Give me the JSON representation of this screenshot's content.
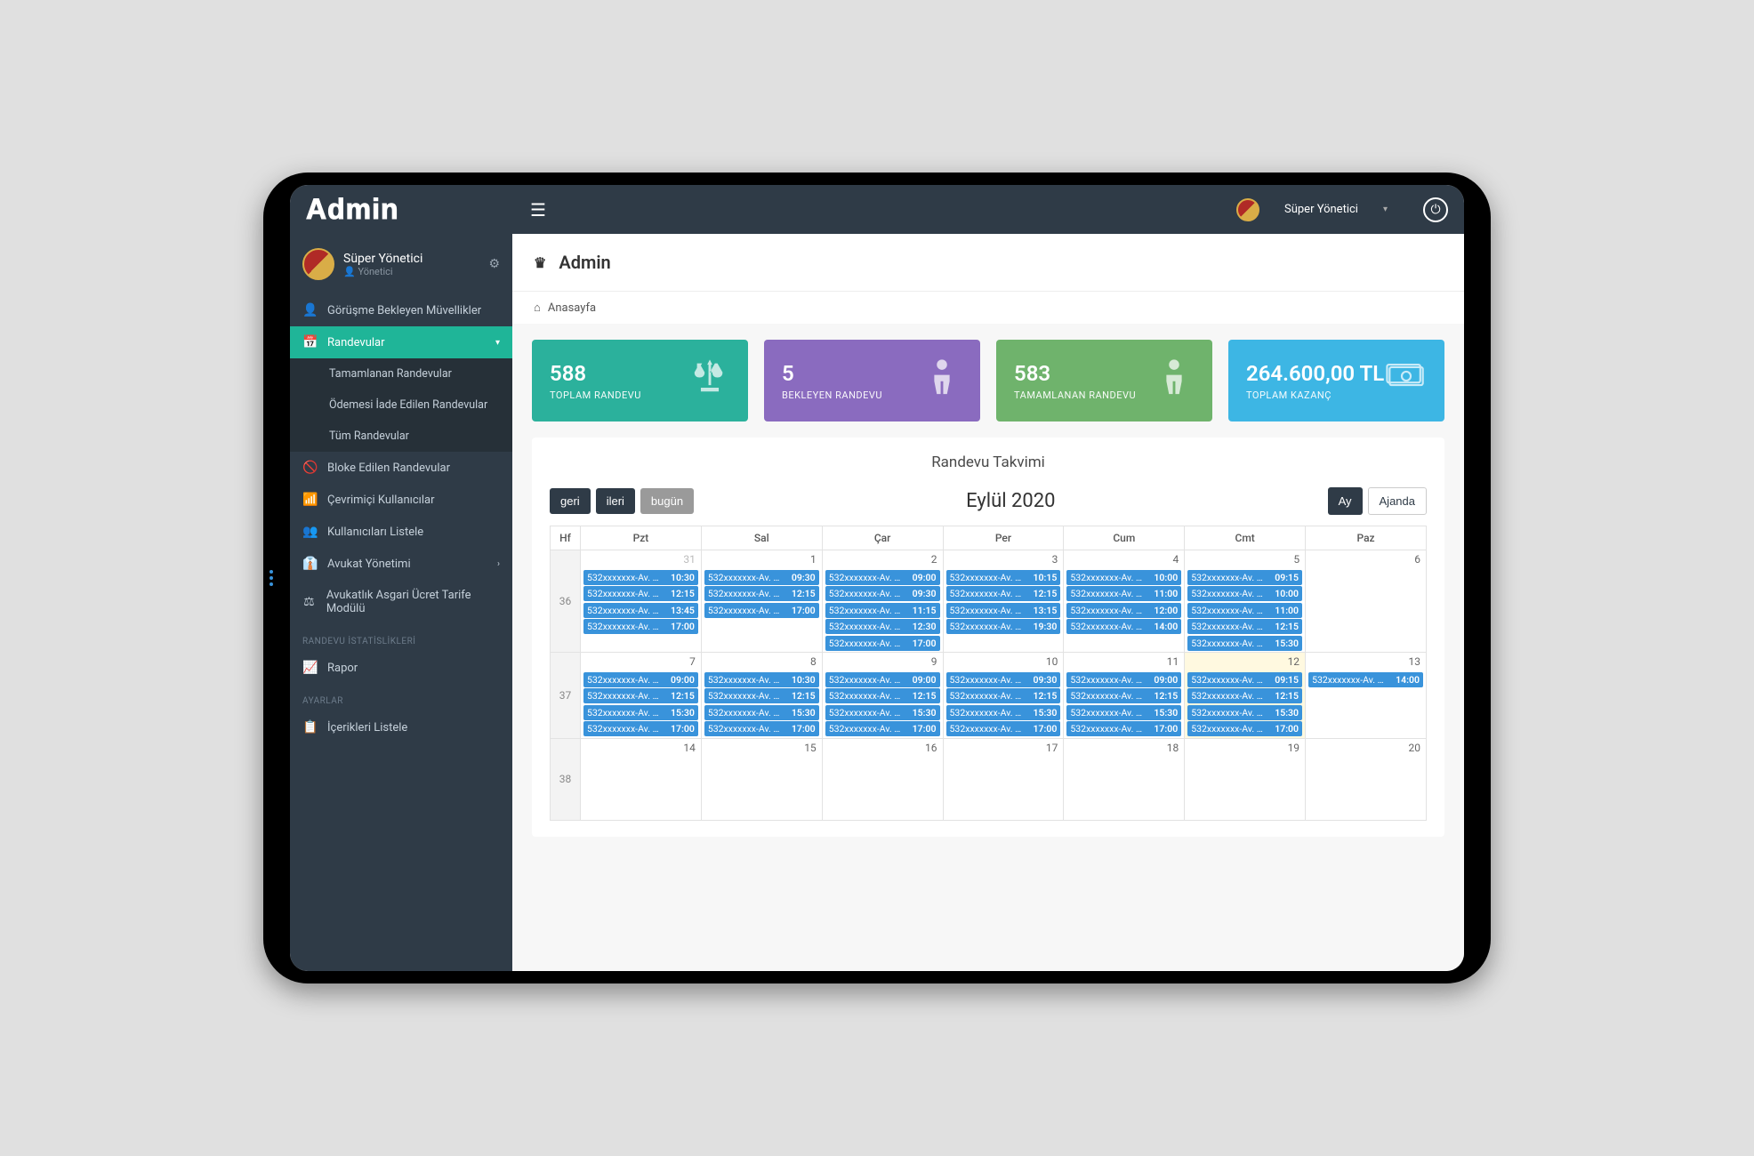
{
  "brand": "Admin",
  "topbar": {
    "user_name": "Süper Yönetici",
    "hamburger_label": "menu"
  },
  "sidebar": {
    "profile": {
      "name": "Süper Yönetici",
      "role": "Yönetici"
    },
    "items": [
      {
        "icon": "👤",
        "label": "Görüşme Bekleyen Müvellikler"
      },
      {
        "icon": "📅",
        "label": "Randevular",
        "active": true,
        "expandable": true
      },
      {
        "icon": "🚫",
        "label": "Bloke Edilen Randevular"
      },
      {
        "icon": "📶",
        "label": "Çevrimiçi Kullanıcılar"
      },
      {
        "icon": "👥",
        "label": "Kullanıcıları Listele"
      },
      {
        "icon": "👔",
        "label": "Avukat Yönetimi",
        "expandable": true
      },
      {
        "icon": "⚖",
        "label": "Avukatlık Asgari Ücret Tarife Modülü"
      }
    ],
    "sub_items": [
      {
        "label": "Tamamlanan Randevular"
      },
      {
        "label": "Ödemesi İade Edilen Randevular"
      },
      {
        "label": "Tüm Randevular"
      }
    ],
    "section_stats": "RANDEVU İSTATİSLİKLERİ",
    "rapor": {
      "icon": "📈",
      "label": "Rapor"
    },
    "section_settings": "AYARLAR",
    "icerik": {
      "icon": "📋",
      "label": "İçerikleri Listele"
    }
  },
  "page": {
    "title": "Admin",
    "breadcrumb": "Anasayfa"
  },
  "stats": [
    {
      "value": "588",
      "label": "TOPLAM RANDEVU",
      "color": "c-teal",
      "icon": "scale"
    },
    {
      "value": "5",
      "label": "BEKLEYEN RANDEVU",
      "color": "c-purple",
      "icon": "person"
    },
    {
      "value": "583",
      "label": "TAMAMLANAN RANDEVU",
      "color": "c-green",
      "icon": "person"
    },
    {
      "value": "264.600,00 TL",
      "label": "TOPLAM KAZANÇ",
      "color": "c-blue",
      "icon": "money"
    }
  ],
  "calendar": {
    "title": "Randevu Takvimi",
    "nav": {
      "prev": "geri",
      "next": "ileri",
      "today": "bugün"
    },
    "month_label": "Eylül 2020",
    "view": {
      "month": "Ay",
      "agenda": "Ajanda"
    },
    "week_header": "Hf",
    "day_headers": [
      "Pzt",
      "Sal",
      "Çar",
      "Per",
      "Cum",
      "Cmt",
      "Paz"
    ],
    "event_name_mask": "532xxxxxxx-Av. …",
    "weeks": [
      {
        "wk": "36",
        "days": [
          {
            "num": "31",
            "other": true,
            "events": [
              {
                "t": "10:30"
              },
              {
                "t": "12:15"
              },
              {
                "t": "13:45"
              },
              {
                "t": "17:00"
              }
            ]
          },
          {
            "num": "1",
            "events": [
              {
                "t": "09:30"
              },
              {
                "t": "12:15"
              },
              {
                "t": "17:00"
              }
            ]
          },
          {
            "num": "2",
            "events": [
              {
                "t": "09:00"
              },
              {
                "t": "09:30"
              },
              {
                "t": "11:15"
              },
              {
                "t": "12:30"
              },
              {
                "t": "17:00"
              }
            ]
          },
          {
            "num": "3",
            "events": [
              {
                "t": "10:15"
              },
              {
                "t": "12:15"
              },
              {
                "t": "13:15"
              },
              {
                "t": "19:30"
              }
            ]
          },
          {
            "num": "4",
            "events": [
              {
                "t": "10:00"
              },
              {
                "t": "11:00"
              },
              {
                "t": "12:00"
              },
              {
                "t": "14:00"
              }
            ]
          },
          {
            "num": "5",
            "events": [
              {
                "t": "09:15"
              },
              {
                "t": "10:00"
              },
              {
                "t": "11:00"
              },
              {
                "t": "12:15"
              },
              {
                "t": "15:30"
              }
            ]
          },
          {
            "num": "6",
            "events": []
          }
        ]
      },
      {
        "wk": "37",
        "days": [
          {
            "num": "7",
            "events": [
              {
                "t": "09:00"
              },
              {
                "t": "12:15"
              },
              {
                "t": "15:30"
              },
              {
                "t": "17:00"
              }
            ]
          },
          {
            "num": "8",
            "events": [
              {
                "t": "10:30"
              },
              {
                "t": "12:15"
              },
              {
                "t": "15:30"
              },
              {
                "t": "17:00"
              }
            ]
          },
          {
            "num": "9",
            "events": [
              {
                "t": "09:00"
              },
              {
                "t": "12:15"
              },
              {
                "t": "15:30"
              },
              {
                "t": "17:00"
              }
            ]
          },
          {
            "num": "10",
            "events": [
              {
                "t": "09:30"
              },
              {
                "t": "12:15"
              },
              {
                "t": "15:30"
              },
              {
                "t": "17:00"
              }
            ]
          },
          {
            "num": "11",
            "events": [
              {
                "t": "09:00"
              },
              {
                "t": "12:15"
              },
              {
                "t": "15:30"
              },
              {
                "t": "17:00"
              }
            ]
          },
          {
            "num": "12",
            "today": true,
            "events": [
              {
                "t": "09:15"
              },
              {
                "t": "12:15"
              },
              {
                "t": "15:30"
              },
              {
                "t": "17:00"
              }
            ]
          },
          {
            "num": "13",
            "events": [
              {
                "t": "14:00"
              }
            ]
          }
        ]
      },
      {
        "wk": "38",
        "days": [
          {
            "num": "14",
            "events": []
          },
          {
            "num": "15",
            "events": []
          },
          {
            "num": "16",
            "events": []
          },
          {
            "num": "17",
            "events": []
          },
          {
            "num": "18",
            "events": []
          },
          {
            "num": "19",
            "events": []
          },
          {
            "num": "20",
            "events": []
          }
        ]
      }
    ]
  }
}
